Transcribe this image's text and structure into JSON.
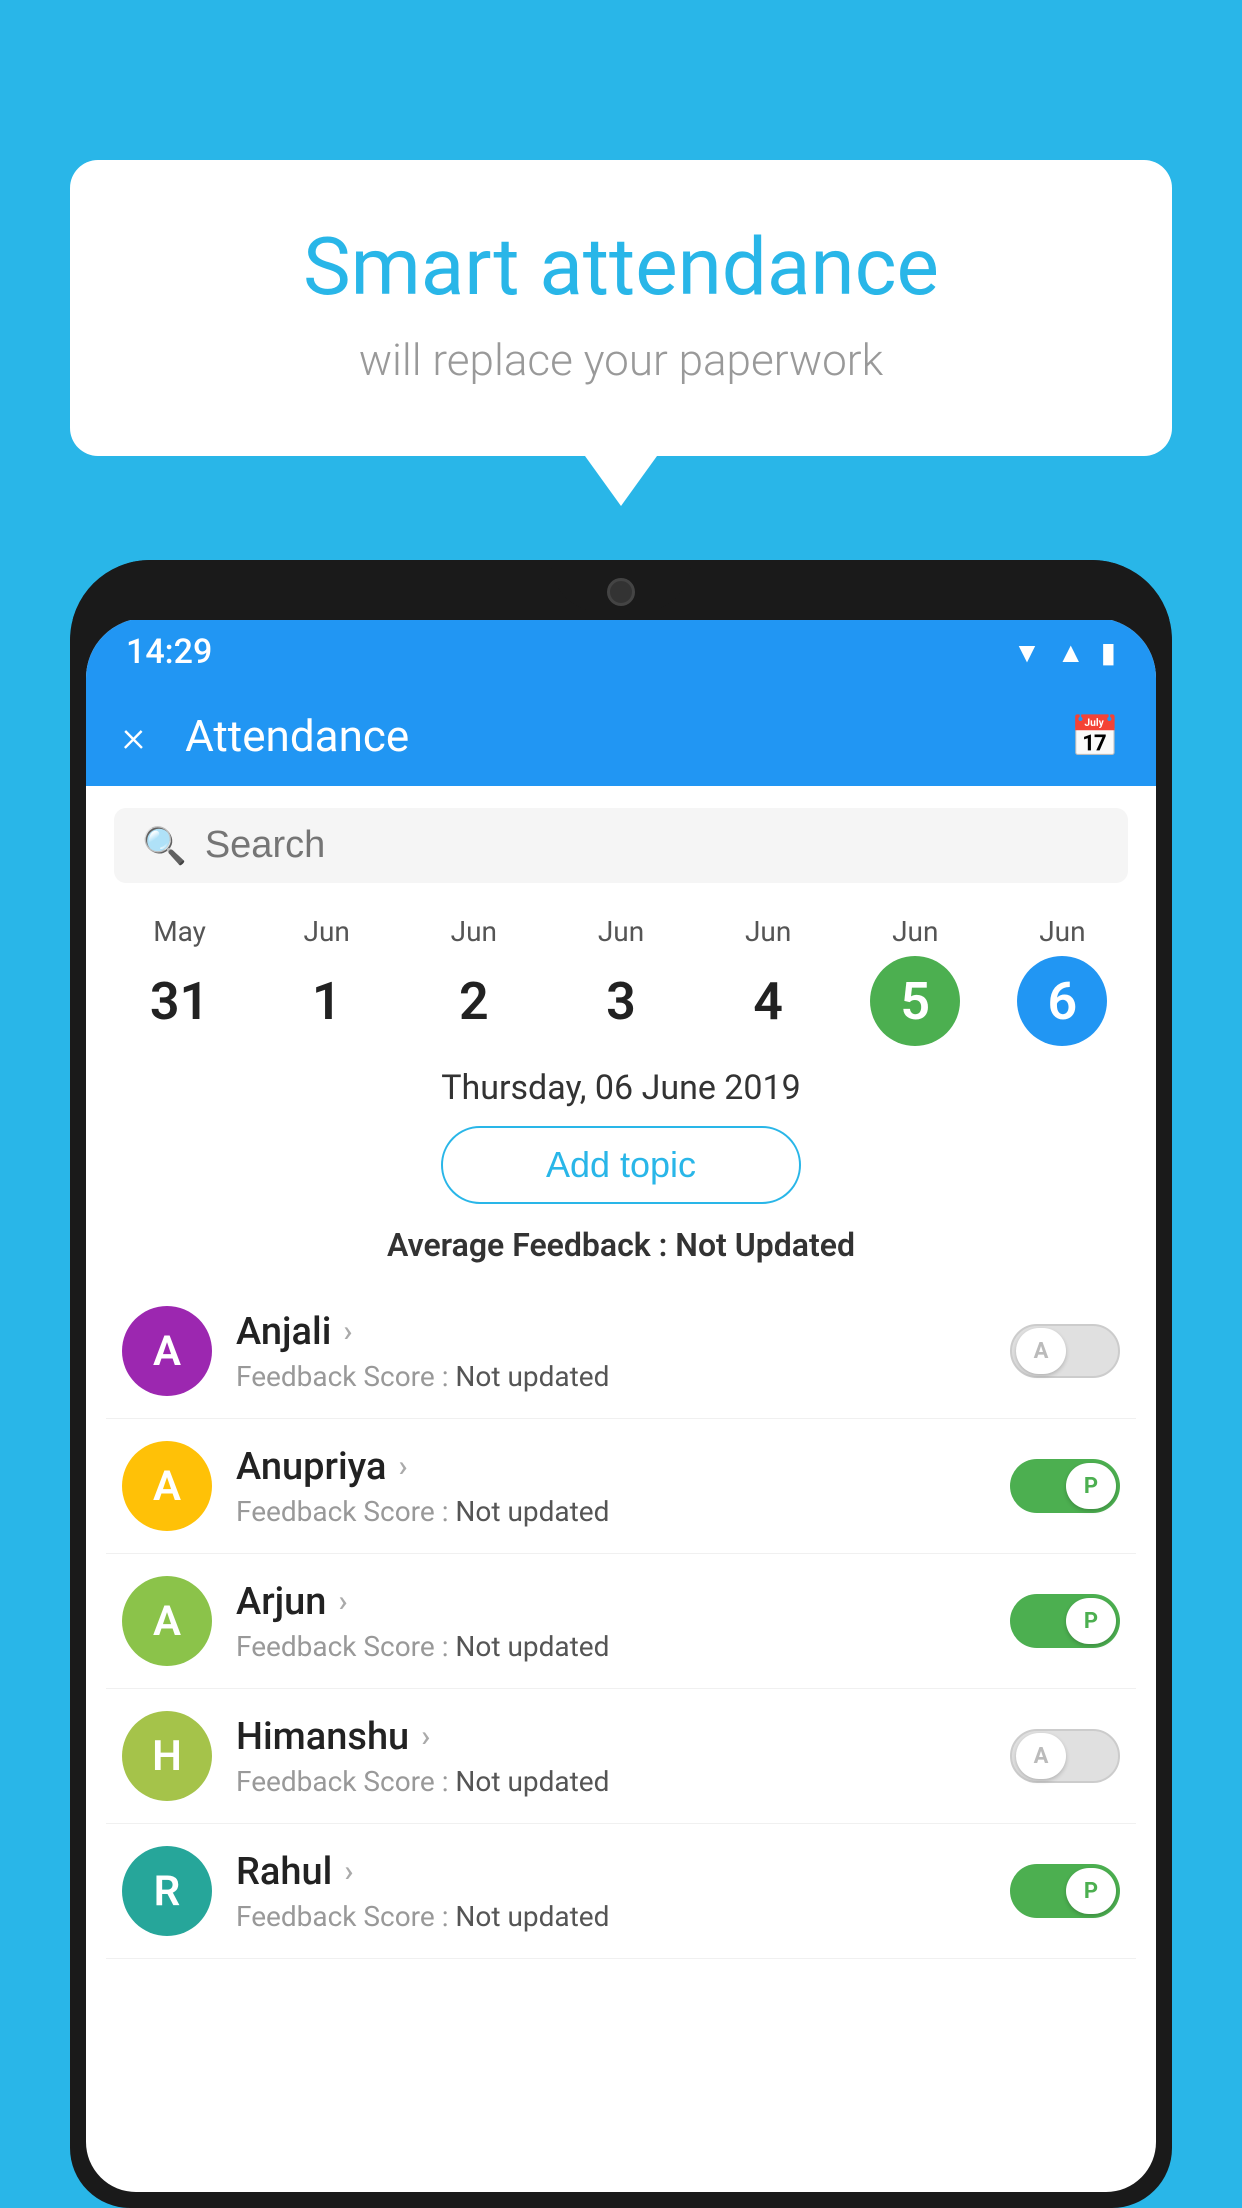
{
  "background_color": "#29b6e8",
  "speech_bubble": {
    "title": "Smart attendance",
    "subtitle": "will replace your paperwork"
  },
  "status_bar": {
    "time": "14:29",
    "icons": [
      "wifi",
      "signal",
      "battery"
    ]
  },
  "header": {
    "title": "Attendance",
    "close_label": "×"
  },
  "search": {
    "placeholder": "Search"
  },
  "dates": [
    {
      "month": "May",
      "day": "31"
    },
    {
      "month": "Jun",
      "day": "1"
    },
    {
      "month": "Jun",
      "day": "2"
    },
    {
      "month": "Jun",
      "day": "3"
    },
    {
      "month": "Jun",
      "day": "4"
    },
    {
      "month": "Jun",
      "day": "5",
      "selected": "green"
    },
    {
      "month": "Jun",
      "day": "6",
      "selected": "blue"
    }
  ],
  "selected_date_label": "Thursday, 06 June 2019",
  "add_topic_label": "Add topic",
  "average_feedback_label": "Average Feedback :",
  "average_feedback_value": "Not Updated",
  "students": [
    {
      "name": "Anjali",
      "avatar_letter": "A",
      "avatar_color": "purple",
      "feedback_label": "Feedback Score :",
      "feedback_value": "Not updated",
      "toggle_state": "off",
      "toggle_letter": "A"
    },
    {
      "name": "Anupriya",
      "avatar_letter": "A",
      "avatar_color": "yellow",
      "feedback_label": "Feedback Score :",
      "feedback_value": "Not updated",
      "toggle_state": "on",
      "toggle_letter": "P"
    },
    {
      "name": "Arjun",
      "avatar_letter": "A",
      "avatar_color": "light-green",
      "feedback_label": "Feedback Score :",
      "feedback_value": "Not updated",
      "toggle_state": "on",
      "toggle_letter": "P"
    },
    {
      "name": "Himanshu",
      "avatar_letter": "H",
      "avatar_color": "olive",
      "feedback_label": "Feedback Score :",
      "feedback_value": "Not updated",
      "toggle_state": "off",
      "toggle_letter": "A"
    },
    {
      "name": "Rahul",
      "avatar_letter": "R",
      "avatar_color": "teal",
      "feedback_label": "Feedback Score :",
      "feedback_value": "Not updated",
      "toggle_state": "on",
      "toggle_letter": "P"
    }
  ]
}
